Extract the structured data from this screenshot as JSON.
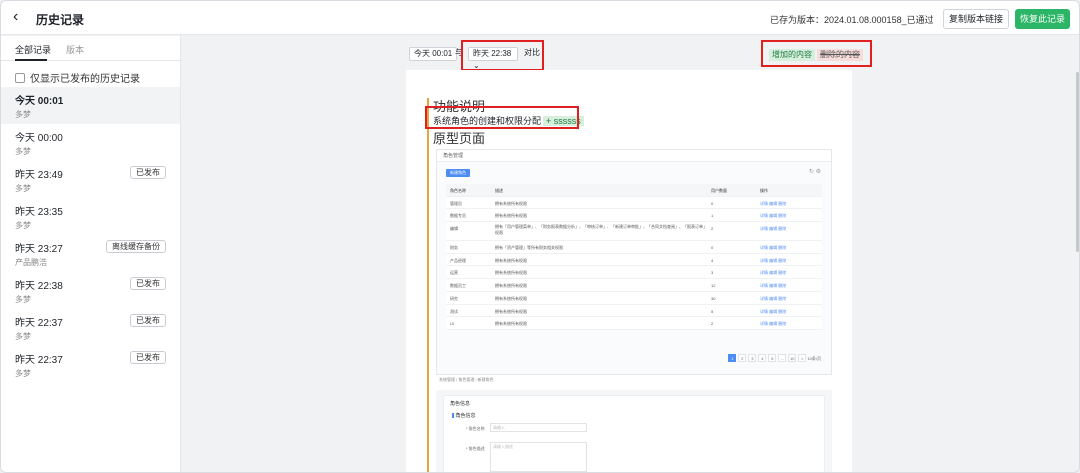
{
  "header": {
    "title": "历史记录",
    "saved_text": "已存为版本：2024.01.08.000158_已通过",
    "copy_link_label": "复制版本链接",
    "restore_label": "恢复此记录"
  },
  "sidebar": {
    "tabs": [
      "全部记录",
      "版本"
    ],
    "only_published_label": "仅显示已发布的历史记录",
    "items": [
      {
        "time": "今天 00:01",
        "user": "多梦",
        "badge": ""
      },
      {
        "time": "今天 00:00",
        "user": "多梦",
        "badge": ""
      },
      {
        "time": "昨天 23:49",
        "user": "多梦",
        "badge": "已发布"
      },
      {
        "time": "昨天 23:35",
        "user": "多梦",
        "badge": ""
      },
      {
        "time": "昨天 23:27",
        "user": "产品鹏浩",
        "badge": "离线缓存备份"
      },
      {
        "time": "昨天 22:38",
        "user": "多梦",
        "badge": "已发布"
      },
      {
        "time": "昨天 22:37",
        "user": "多梦",
        "badge": "已发布"
      },
      {
        "time": "昨天 22:37",
        "user": "多梦",
        "badge": "已发布"
      }
    ]
  },
  "compare": {
    "left_version": "今天 00:01",
    "with_text": "与",
    "right_version": "昨天 22:38",
    "compare_text": "对比",
    "legend_added": "增加的内容",
    "legend_deleted": "删除的内容"
  },
  "doc": {
    "heading_function": "功能说明",
    "line_text": "系统角色的创建和权限分配",
    "added_text": "+ ssssss",
    "heading_prototype": "原型页面"
  },
  "embedded_screenshot": {
    "page_title": "角色管理",
    "new_button": "新建角色",
    "columns": [
      "角色名称",
      "描述",
      "用户数量",
      "操作"
    ],
    "rows": [
      [
        "管理员",
        "拥有系统所有权限",
        "0",
        "详情 编辑 删除"
      ],
      [
        "数据专员",
        "拥有系统所有权限",
        "1",
        "详情 编辑 删除"
      ],
      [
        "编辑",
        "拥有「用户管理菜单」、「财务报表数据分析」、「审核订单」、「新建订单审批」、「合同文档查阅」、「报表订单」权限",
        "2",
        "详情 编辑 删除"
      ],
      [
        "财务",
        "拥有「资产管理」等所有财务相关权限",
        "0",
        "详情 编辑 删除"
      ],
      [
        "产品经理",
        "拥有系统所有权限",
        "4",
        "详情 编辑 删除"
      ],
      [
        "运营",
        "拥有系统所有权限",
        "3",
        "详情 编辑 删除"
      ],
      [
        "数据员工",
        "拥有系统所有权限",
        "12",
        "详情 编辑 删除"
      ],
      [
        "研究",
        "拥有系统所有权限",
        "30",
        "详情 编辑 删除"
      ],
      [
        "测试",
        "拥有系统所有权限",
        "5",
        "详情 编辑 删除"
      ],
      [
        "UI",
        "拥有系统所有权限",
        "2",
        "详情 编辑 删除"
      ]
    ],
    "pager": [
      "1",
      "2",
      "3",
      "4",
      "5",
      "...",
      "10",
      ">"
    ],
    "pager_size": "10条/页",
    "breadcrumb": "系统管理 / 角色管理 / 新建角色",
    "form_section": "角色信息",
    "form_sub": "角色信息",
    "field_name_label": "* 角色名称",
    "field_name_placeholder": "请输入",
    "field_desc_label": "* 角色描述",
    "field_desc_placeholder": "请输入描述"
  }
}
